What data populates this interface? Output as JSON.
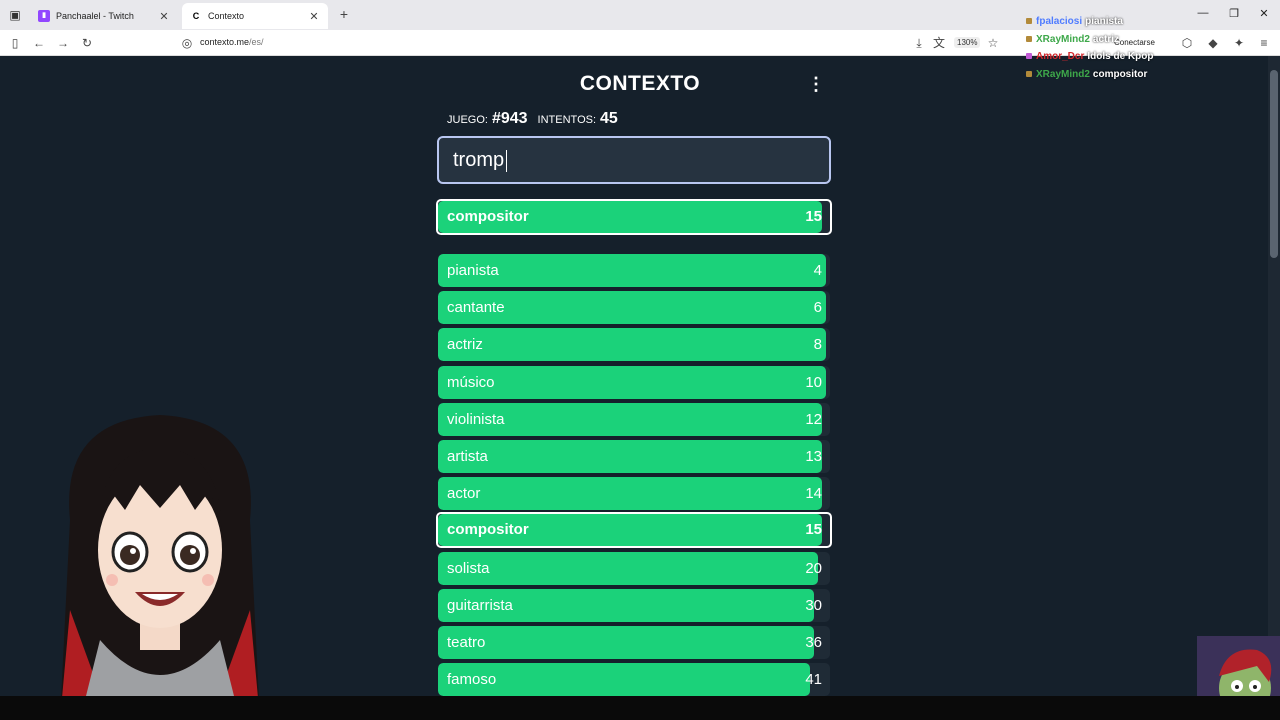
{
  "browser": {
    "tabs": [
      {
        "title": "Panchaalel - Twitch"
      },
      {
        "title": "Contexto"
      }
    ],
    "url_host": "contexto.me",
    "url_path": "/es/",
    "zoom": "130%",
    "connect_label": "Conectarse"
  },
  "game": {
    "logo": "CONTEXTO",
    "game_label": "juego:",
    "game_number": "#943",
    "attempts_label": "intentos:",
    "attempts": "45",
    "input_value": "tromp",
    "last_guess": {
      "word": "compositor",
      "rank": "15",
      "fill": 0.98
    },
    "guesses": [
      {
        "word": "pianista",
        "rank": "4",
        "fill": 0.99
      },
      {
        "word": "cantante",
        "rank": "6",
        "fill": 0.99
      },
      {
        "word": "actriz",
        "rank": "8",
        "fill": 0.99
      },
      {
        "word": "músico",
        "rank": "10",
        "fill": 0.99
      },
      {
        "word": "violinista",
        "rank": "12",
        "fill": 0.98
      },
      {
        "word": "artista",
        "rank": "13",
        "fill": 0.98
      },
      {
        "word": "actor",
        "rank": "14",
        "fill": 0.98
      },
      {
        "word": "compositor",
        "rank": "15",
        "fill": 0.98,
        "highlight": true
      },
      {
        "word": "solista",
        "rank": "20",
        "fill": 0.97
      },
      {
        "word": "guitarrista",
        "rank": "30",
        "fill": 0.96
      },
      {
        "word": "teatro",
        "rank": "36",
        "fill": 0.96
      },
      {
        "word": "famoso",
        "rank": "41",
        "fill": 0.95
      }
    ]
  },
  "chat": [
    {
      "user": "fpalaciosi",
      "msg": "pianista",
      "color": "#4f7cff"
    },
    {
      "user": "XRayMind2",
      "msg": "actriz",
      "color": "#3ea84a"
    },
    {
      "user": "Amor_Dcr",
      "msg": "Idols de Kpop",
      "color": "#d4282d"
    },
    {
      "user": "XRayMind2",
      "msg": "compositor",
      "color": "#3ea84a"
    }
  ],
  "colors": {
    "background": "#15202b",
    "bar_green": "#1bd27a",
    "input_bg": "#263340"
  }
}
